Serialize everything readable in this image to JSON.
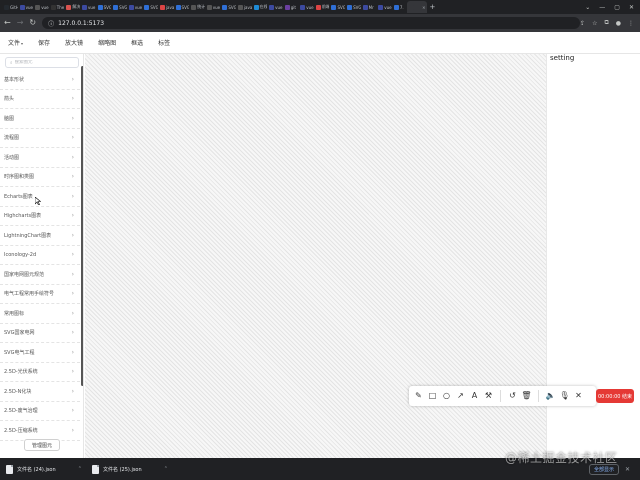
{
  "browser": {
    "tabs": [
      {
        "label": "GitH",
        "color": "#24292f"
      },
      {
        "label": "vue",
        "color": "#3c4aa0"
      },
      {
        "label": "vue",
        "color": "#555555"
      },
      {
        "label": "The",
        "color": "#333333"
      },
      {
        "label": "解决",
        "color": "#d9534f"
      },
      {
        "label": "vue",
        "color": "#3c4aa0"
      },
      {
        "label": "SVG",
        "color": "#2f6fd6"
      },
      {
        "label": "SVG",
        "color": "#2f6fd6"
      },
      {
        "label": "vue",
        "color": "#3c4aa0"
      },
      {
        "label": "SVG",
        "color": "#2f6fd6"
      },
      {
        "label": "javas",
        "color": "#d44"
      },
      {
        "label": "SVG",
        "color": "#2f6fd6"
      },
      {
        "label": "统计",
        "color": "#555555"
      },
      {
        "label": "vue",
        "color": "#555555"
      },
      {
        "label": "SVG",
        "color": "#2f6fd6"
      },
      {
        "label": "java",
        "color": "#555555"
      },
      {
        "label": "在线",
        "color": "#1e8bd6"
      },
      {
        "label": "vue",
        "color": "#3c4aa0"
      },
      {
        "label": "git",
        "color": "#6b3fa0"
      },
      {
        "label": "vue",
        "color": "#3c4aa0"
      },
      {
        "label": "前端",
        "color": "#d44"
      },
      {
        "label": "SVG",
        "color": "#2f6fd6"
      },
      {
        "label": "SVG",
        "color": "#2f6fd6"
      },
      {
        "label": "Mr",
        "color": "#3c4aa0"
      },
      {
        "label": "vue",
        "color": "#3c4aa0"
      },
      {
        "label": "7.",
        "color": "#2f6fd6"
      },
      {
        "label": "",
        "color": "#35363a",
        "active": true
      }
    ],
    "new_tab": "+",
    "url": "127.0.0.1:5173"
  },
  "menu": {
    "items": [
      "文件",
      "保存",
      "放大镜",
      "缩略图",
      "框选",
      "标签"
    ]
  },
  "sidebar": {
    "search_placeholder": "搜索图元",
    "categories": [
      "基本形状",
      "箭头",
      "脑图",
      "流程图",
      "活动图",
      "时序图和类图",
      "Echarts图表",
      "Highcharts图表",
      "LightningChart图表",
      "Iconology-2d",
      "国家电网图元规范",
      "电气工程常用手绘符号",
      "常用图标",
      "SVG国家电网",
      "SVG电气工程",
      "2.5D-光伏系统",
      "2.5D-Ν化块",
      "2.5D-废气治理",
      "2.5D-压缩系统"
    ],
    "manage_button": "管理图元"
  },
  "setting": {
    "title": "setting"
  },
  "toolbar": {
    "tools": [
      {
        "icon": "pencil-icon",
        "glyph": "✎"
      },
      {
        "icon": "rectangle-icon",
        "glyph": "□"
      },
      {
        "icon": "circle-icon",
        "glyph": "○"
      },
      {
        "icon": "arrow-icon",
        "glyph": "↗"
      },
      {
        "icon": "text-icon",
        "glyph": "A"
      },
      {
        "icon": "mosaic-brush-icon",
        "glyph": "⚒"
      },
      {
        "icon": "undo-icon",
        "glyph": "↺"
      },
      {
        "icon": "trash-icon",
        "glyph": "🗑"
      },
      {
        "icon": "speaker-icon",
        "glyph": "🔈"
      },
      {
        "icon": "microphone-icon",
        "glyph": "🎙"
      },
      {
        "icon": "close-icon",
        "glyph": "✕"
      }
    ],
    "record_badge": "00:00:00 结束"
  },
  "downloads": {
    "items": [
      "文件名 (24).json",
      "文件名 (25).json"
    ],
    "show_all": "全部显示"
  },
  "watermark": "@稀土掘金技术社区"
}
